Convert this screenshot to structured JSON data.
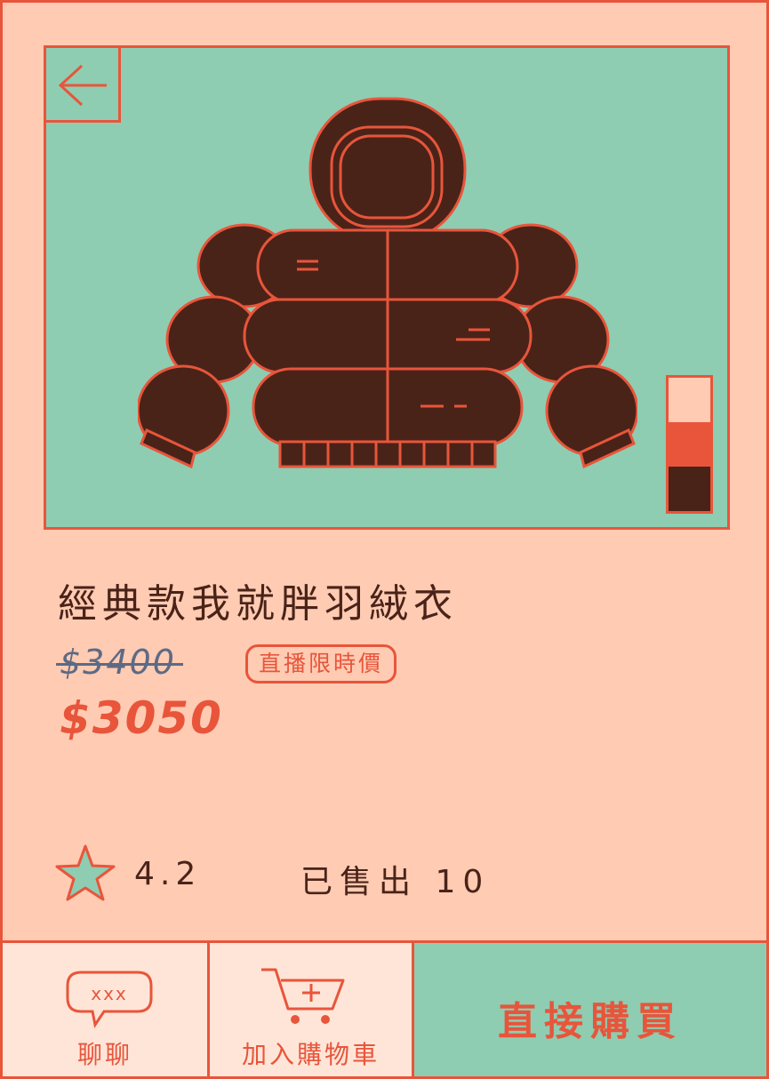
{
  "product": {
    "title": "經典款我就胖羽絨衣",
    "original_price": "$3400",
    "promo_badge": "直播限時價",
    "sale_price": "$3050"
  },
  "stats": {
    "rating": "4.2",
    "sold": "已售出 10"
  },
  "actions": {
    "chat_label": "聊聊",
    "chat_bubble_text": "xxx",
    "add_to_cart_label": "加入購物車",
    "buy_now_label": "直接購買"
  },
  "color_options": [
    "#ffcbb3",
    "#e8553b",
    "#4a2318"
  ],
  "colors": {
    "background": "#ffcbb3",
    "accent": "#e8553b",
    "mint": "#8ecdb2",
    "brown": "#4a2318",
    "strike": "#5d6a85"
  },
  "icons": [
    "back-arrow-icon",
    "jacket-image",
    "star-icon",
    "chat-bubble-icon",
    "cart-icon"
  ]
}
